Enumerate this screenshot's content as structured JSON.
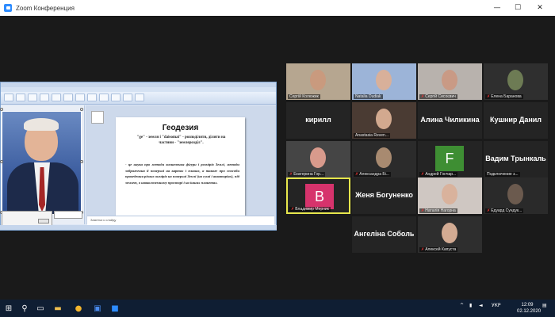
{
  "window": {
    "title": "Zoom Конференция",
    "minimize": "—",
    "maximize": "☐",
    "close": "✕"
  },
  "presentation": {
    "slide_title": "Геодезия",
    "slide_subtitle_line1": "\"ge\" - земля і \"daisomai\" - розподіляти, ділити на",
    "slide_subtitle_line2": "частини - \"землерозділ\".",
    "bullet": "-",
    "body": "це наука про методи визначення фігури і розмірів Землі, методи зображення її поверхні на картах і планах, а також про способи проведення різних вимірів на поверхні Землі (на суші і акваторіях), під землею, в навколоземному просторі і на інших планетах.",
    "notes_placeholder": "Заметки к слайду"
  },
  "participants": [
    {
      "name": "Сергій Колюжик",
      "type": "video",
      "bg": "#b6a690",
      "face": "#c99a7e"
    },
    {
      "name": "Natalia Dudiak",
      "type": "video",
      "bg": "#9cb4d8",
      "face": "#d8b09a"
    },
    {
      "name": "Сергій Сисоєвич",
      "type": "video",
      "bg": "#b8b2ad",
      "face": "#c99a85",
      "muted": true
    },
    {
      "name": "Елена Баранова",
      "type": "video",
      "bg": "#2f2f2f",
      "face": "#6d7b54",
      "muted": true
    },
    {
      "name": "кирилл",
      "type": "text"
    },
    {
      "name": "Anastasia Reven...",
      "type": "video",
      "bg": "#4a3b33",
      "face": "#d2a98f"
    },
    {
      "name": "Алина Чиликина",
      "type": "text"
    },
    {
      "name": "Кушнир Данил",
      "type": "text"
    },
    {
      "name": "Екатерина Гор...",
      "type": "video",
      "bg": "#454545",
      "face": "#d89a8c",
      "muted": true
    },
    {
      "name": "Александра Бі...",
      "type": "video",
      "bg": "#2b2b2b",
      "face": "#a88a70",
      "muted": true
    },
    {
      "name": "Андрей Гончар...",
      "type": "initial",
      "letter": "F",
      "color": "#3e8e33",
      "muted": true
    },
    {
      "name": "Вадим Трынкаль",
      "type": "text",
      "sub": "Подключение з..."
    },
    {
      "name": "Владимир Мерник",
      "type": "initial",
      "letter": "B",
      "color": "#d6336c",
      "muted": true,
      "active": true
    },
    {
      "name": "Женя Богуненко",
      "type": "text"
    },
    {
      "name": "Наталія Нагорна",
      "type": "video",
      "bg": "#cfc7c2",
      "face": "#d9b29c",
      "muted": true
    },
    {
      "name": "Едуард Сундук...",
      "type": "video",
      "bg": "#2a2a2a",
      "face": "#6b5a4e",
      "muted": true
    },
    {
      "name": "Ангеліна Соболь",
      "type": "text"
    },
    {
      "name": "Алексей Капуста",
      "type": "video",
      "bg": "#2e2e2e",
      "face": "#d3ab93",
      "muted": true
    }
  ],
  "taskbar": {
    "start_icon": "windows-icon",
    "lang": "УКР",
    "time": "12:09",
    "date": "02.12.2020"
  }
}
